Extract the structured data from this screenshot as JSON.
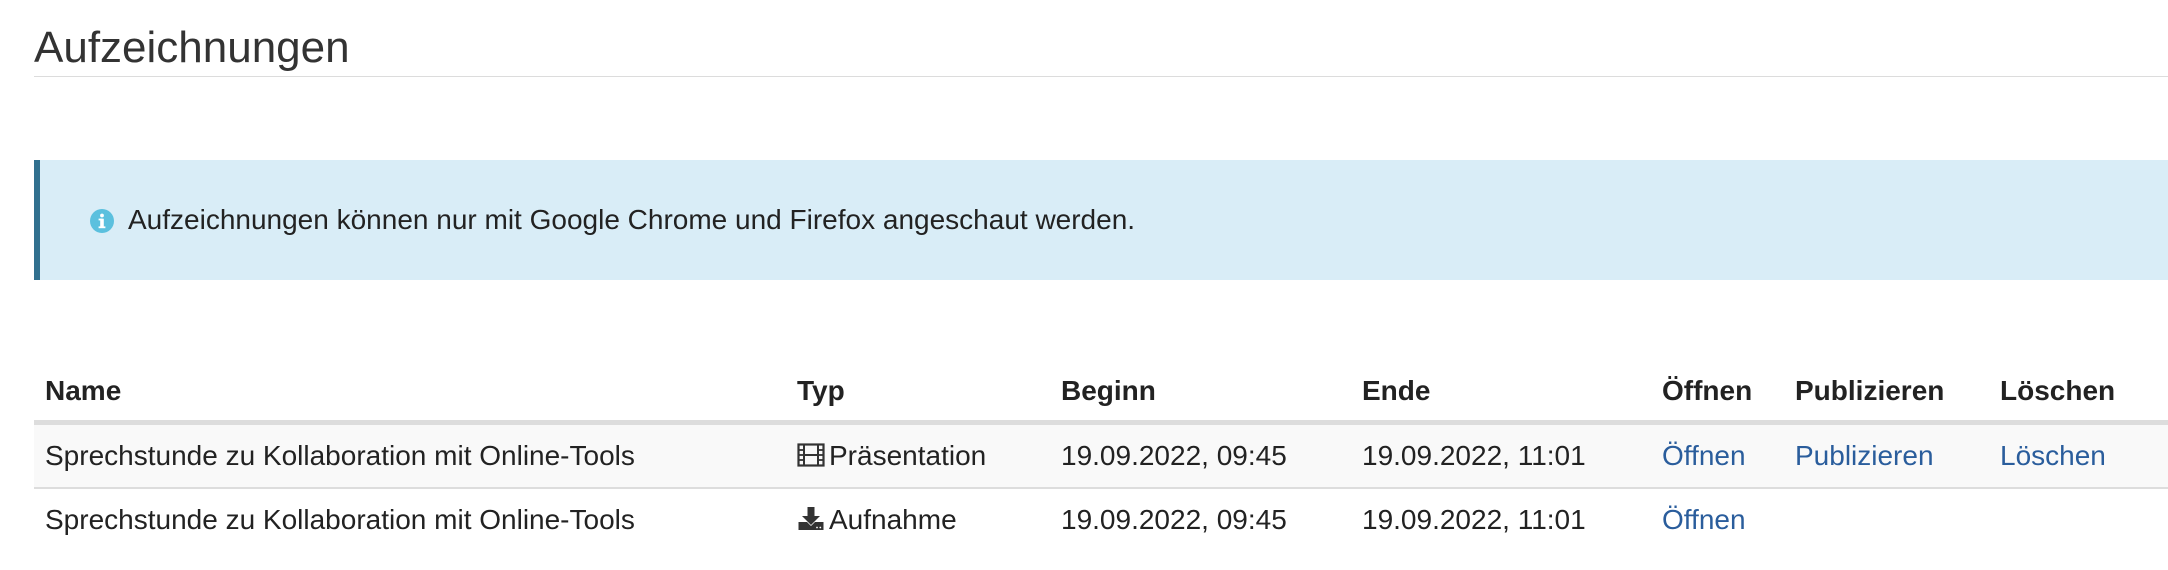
{
  "page": {
    "title": "Aufzeichnungen"
  },
  "alert": {
    "icon": "info-circle-icon",
    "text": "Aufzeichnungen können nur mit Google Chrome und Firefox angeschaut werden.",
    "background": "#d9edf7",
    "border_color": "#31708f",
    "icon_color": "#5bc0de"
  },
  "table": {
    "columns": [
      "Name",
      "Typ",
      "Beginn",
      "Ende",
      "Öffnen",
      "Publizieren",
      "Löschen"
    ],
    "rows": [
      {
        "name": "Sprechstunde zu Kollaboration mit Online-Tools",
        "type_icon": "film-icon",
        "type": "Präsentation",
        "begin": "19.09.2022, 09:45",
        "end": "19.09.2022, 11:01",
        "open": "Öffnen",
        "publish": "Publizieren",
        "delete": "Löschen"
      },
      {
        "name": "Sprechstunde zu Kollaboration mit Online-Tools",
        "type_icon": "download-icon",
        "type": "Aufnahme",
        "begin": "19.09.2022, 09:45",
        "end": "19.09.2022, 11:01",
        "open": "Öffnen",
        "publish": "",
        "delete": ""
      }
    ],
    "link_color": "#2a5d9c"
  }
}
